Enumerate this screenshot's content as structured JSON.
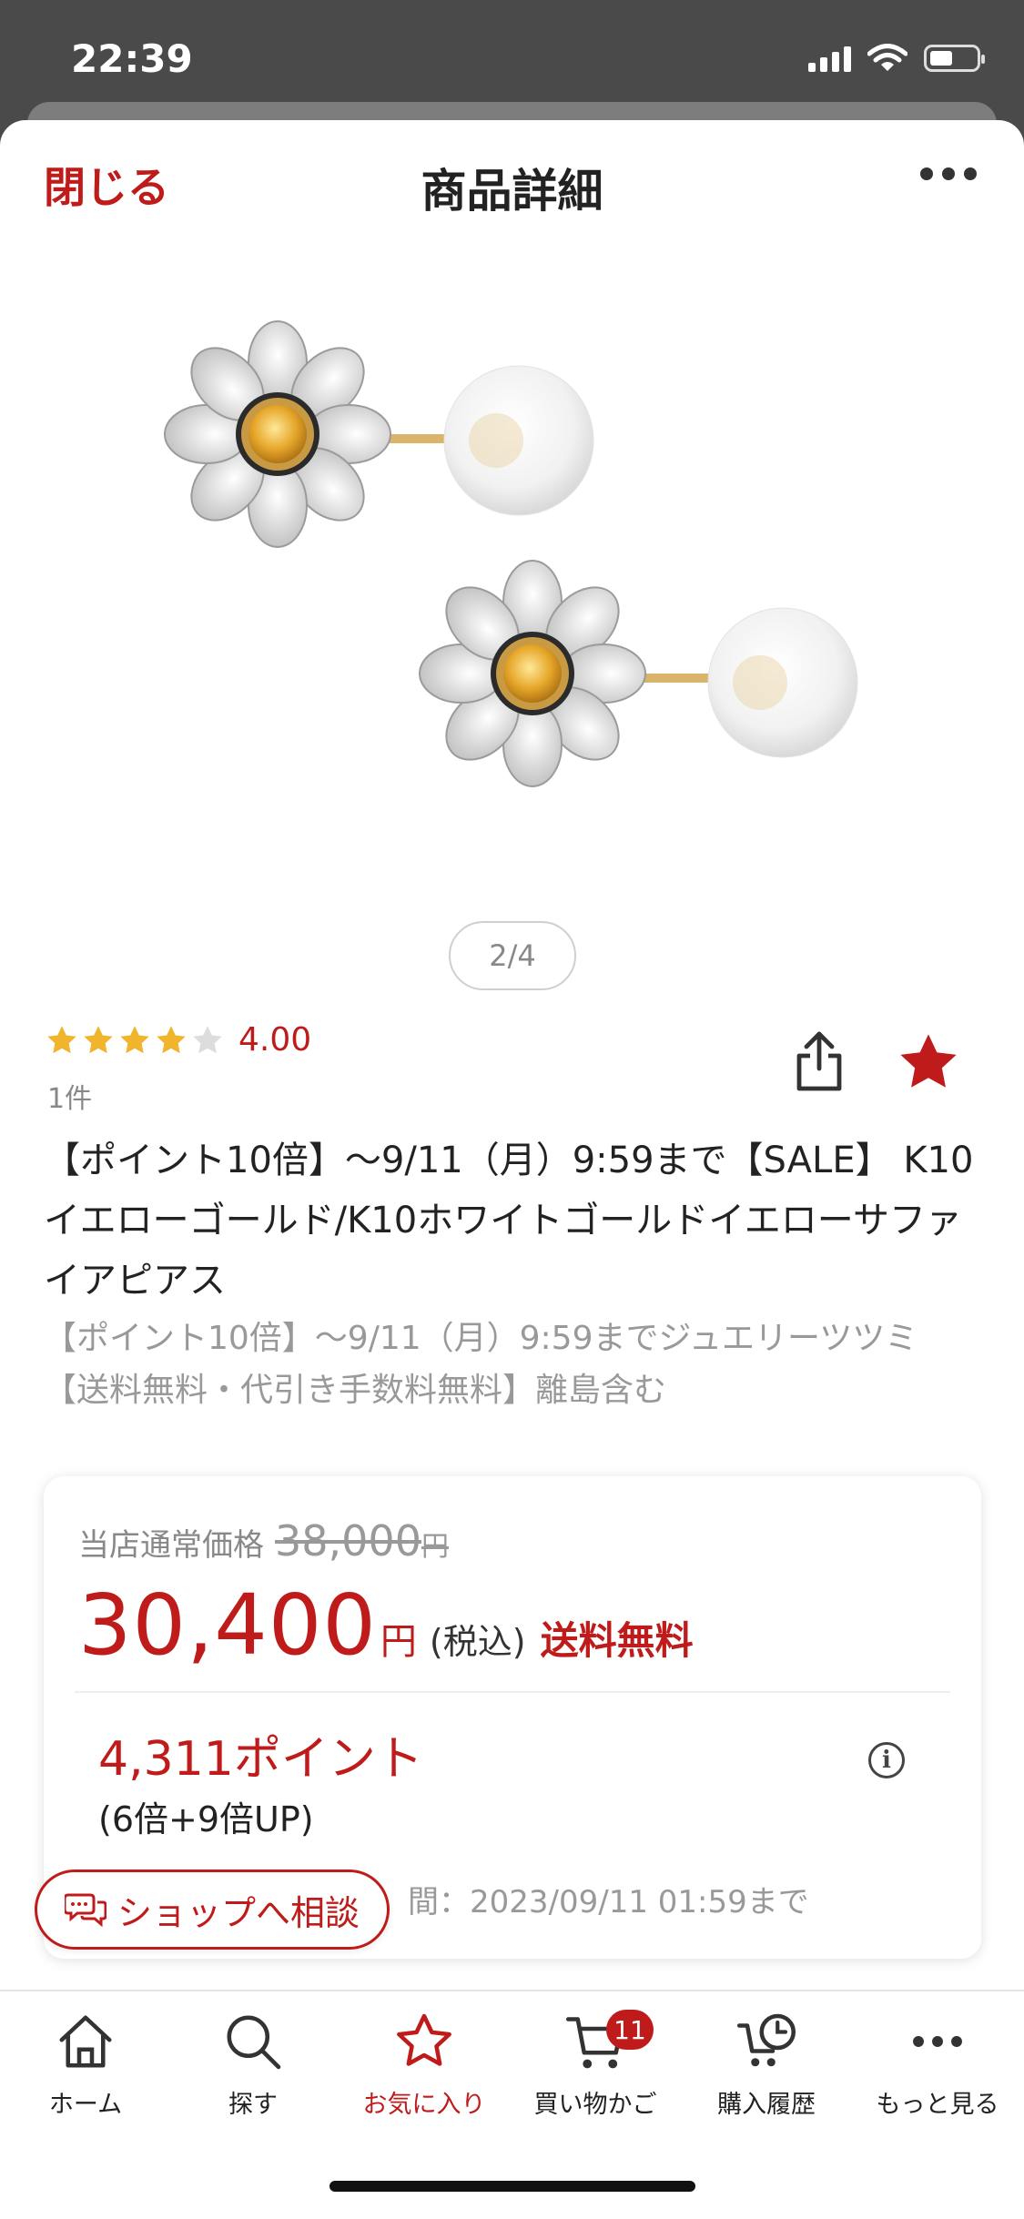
{
  "status_bar": {
    "time": "22:39"
  },
  "header": {
    "close_label": "閉じる",
    "title": "商品詳細"
  },
  "gallery": {
    "page_indicator": "2/4"
  },
  "review": {
    "rating": 4,
    "rating_max": 5,
    "rating_label": "4.00",
    "count_label": "1件"
  },
  "product": {
    "title": "【ポイント10倍】〜9/11（月）9:59まで【SALE】 K10イエローゴールド/K10ホワイトゴールドイエローサファイアピアス",
    "subtitle": "【ポイント10倍】〜9/11（月）9:59までジュエリーツツミ【送料無料・代引き手数料無料】離島含む"
  },
  "price": {
    "regular_label": "当店通常価格",
    "regular_price": "38,000",
    "regular_yen": "円",
    "sale_price": "30,400",
    "sale_yen": "円",
    "tax_label": "(税込)",
    "shipping_label": "送料無料",
    "points_label": "4,311ポイント",
    "points_multiplier": "(6倍+9倍UP)",
    "period_label": "間：2023/09/11 01:59まで"
  },
  "consult_button": {
    "label": "ショップへ相談"
  },
  "tab_bar": {
    "home": "ホーム",
    "search": "探す",
    "favorites": "お気に入り",
    "cart": "買い物かご",
    "cart_badge": "11",
    "history": "購入履歴",
    "more": "もっと見る"
  },
  "colors": {
    "accent": "#bf1b1b",
    "star": "#f0b52d",
    "star_empty": "#dddddd"
  }
}
